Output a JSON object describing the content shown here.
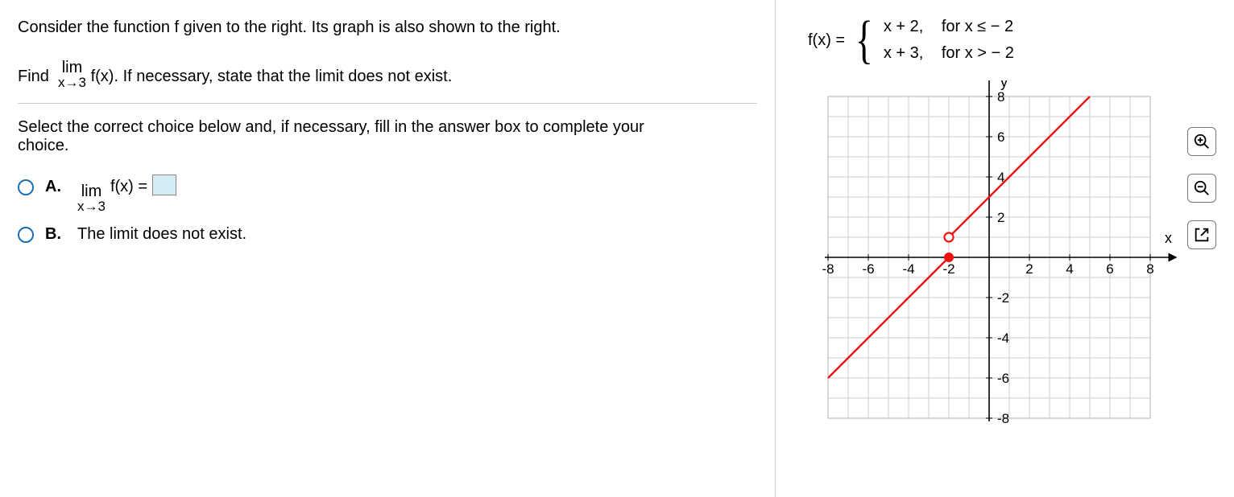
{
  "question": {
    "intro": "Consider the function f given to the right. Its graph is also shown to the right.",
    "task_prefix": "Find",
    "limit_word": "lim",
    "limit_fn": "f(x).",
    "limit_sub": "x→3",
    "task_suffix": "If necessary, state that the limit does not exist.",
    "instruction": "Select the correct choice below and, if necessary, fill in the answer box to complete your choice."
  },
  "choices": {
    "A": {
      "label": "A.",
      "limit_word": "lim",
      "limit_fn": "f(x) =",
      "limit_sub": "x→3"
    },
    "B": {
      "label": "B.",
      "text": "The limit does not exist."
    }
  },
  "fn_def": {
    "lhs": "f(x) =",
    "piece1_expr": "x + 2,",
    "piece1_cond": "for x ≤  − 2",
    "piece2_expr": "x + 3,",
    "piece2_cond": "for x >  − 2"
  },
  "graph": {
    "x_label": "x",
    "y_label": "y",
    "xmin": -8,
    "xmax": 8,
    "ymin": -8,
    "ymax": 8,
    "xticks": [
      -8,
      -6,
      -4,
      -2,
      2,
      4,
      6,
      8
    ],
    "yticks": [
      -8,
      -6,
      -4,
      -2,
      2,
      4,
      6,
      8
    ],
    "line1": {
      "x1": -8,
      "y1": -6,
      "x2": -2,
      "y2": 0,
      "end": "closed"
    },
    "line2": {
      "x1": -2,
      "y1": 1,
      "x2": 6,
      "y2": 9,
      "start": "open"
    }
  },
  "tools": {
    "zoom_in": "zoom-in-icon",
    "zoom_out": "zoom-out-icon",
    "popout": "popout-icon"
  }
}
